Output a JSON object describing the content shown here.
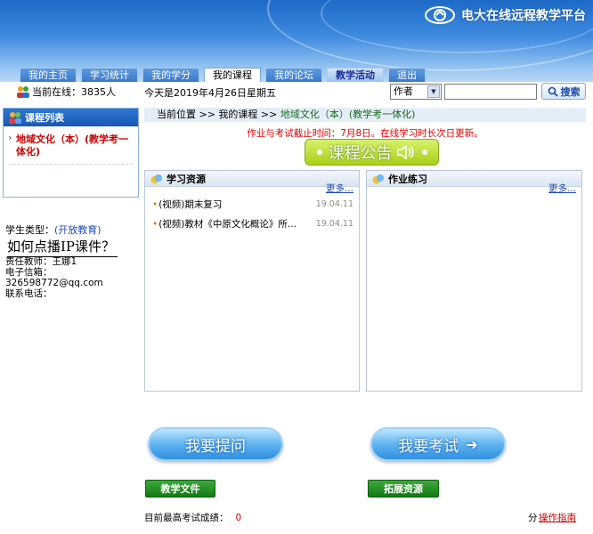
{
  "header": {
    "brand": "电大在线远程教学平台"
  },
  "nav": {
    "tabs": [
      {
        "label": "我的主页"
      },
      {
        "label": "学习统计"
      },
      {
        "label": "我的学分"
      },
      {
        "label": "我的课程"
      },
      {
        "label": "我的论坛"
      },
      {
        "label": "教学活动"
      },
      {
        "label": "退出"
      }
    ],
    "active": "我的课程"
  },
  "infobar": {
    "online": "当前在线：3835人",
    "date": "今天是2019年4月26日星期五",
    "search_field": "作者",
    "search_value": "",
    "search_button": "搜索"
  },
  "sidebar": {
    "course_list_title": "课程列表",
    "course_item": "地域文化（本）(教学考一体化)",
    "student_type_label": "学生类型：",
    "student_type_value": "(开放教育)",
    "howto": "如何点播IP课件？",
    "teacher": "责任教师：王娜1",
    "email_label": "电子信箱：",
    "email": "326598772@qq.com",
    "phone": "联系电话："
  },
  "main": {
    "breadcrumb": {
      "prefix": "当前位置 >> 我的课程 >> ",
      "current": "地域文化（本）(教学考一体化)"
    },
    "deadline": "作业与考试截止时间：7月8日。在线学习时长次日更新。",
    "announce": "课程公告",
    "resources": {
      "title": "学习资源",
      "more": "更多...",
      "items": [
        {
          "title": "(视频)期末复习",
          "date": "19.04.11"
        },
        {
          "title": "(视频)教材《中原文化概论》所...",
          "date": "19.04.11"
        }
      ]
    },
    "homework": {
      "title": "作业练习",
      "more": "更多..."
    },
    "ask_button": "我要提问",
    "exam_button": "我要考试",
    "docs_button": "教学文件",
    "ext_button": "拓展资源",
    "score_label": "目前最高考试成绩：",
    "score_value": "0",
    "score_unit": "分",
    "guide": "操作指南"
  },
  "colors": {
    "header_blue": "#1d6ac7",
    "deadline_red": "#e00000",
    "announce_green": "#a8d01a",
    "button_green": "#137a13"
  }
}
